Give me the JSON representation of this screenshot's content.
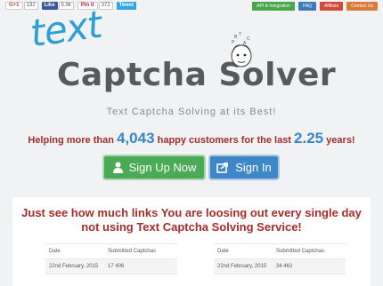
{
  "social": {
    "gplus": {
      "label": "G+1",
      "count": "132"
    },
    "facebook": {
      "label": "Like",
      "count": "5.9k"
    },
    "pinterest": {
      "label": "Pin it",
      "count": "372"
    },
    "twitter": {
      "label": "Tweet"
    }
  },
  "nav": {
    "api": "API & Integration",
    "faq": "FAQ",
    "affiliate": "Affiliate",
    "contact": "Contact Us"
  },
  "logo": {
    "small": "text",
    "main": "Captcha Solver",
    "letters": [
      "B",
      "T",
      "P",
      "C",
      "A"
    ]
  },
  "subtitle": "Text Captcha Solving at its Best!",
  "customers": {
    "prefix": "Helping more than ",
    "count": "4,043",
    "middle": " happy customers for the last ",
    "years": "2.25",
    "suffix": " years!"
  },
  "buttons": {
    "signup": "Sign Up Now",
    "signin": "Sign In"
  },
  "panel": {
    "title": "Just see how much links You are loosing out every single day not using Text Captcha Solving Service!",
    "headers": {
      "date": "Date",
      "captchas": "Submitted Captchas"
    },
    "left": [
      {
        "date": "22nd February, 2015",
        "captchas": "17 406"
      }
    ],
    "right": [
      {
        "date": "22nd February, 2015",
        "captchas": "34 462"
      }
    ]
  },
  "colors": {
    "accent_blue": "#2b9fd6",
    "red_text": "#a62c2c",
    "signup_green": "#4aaa55",
    "signin_blue": "#3f87c6"
  }
}
